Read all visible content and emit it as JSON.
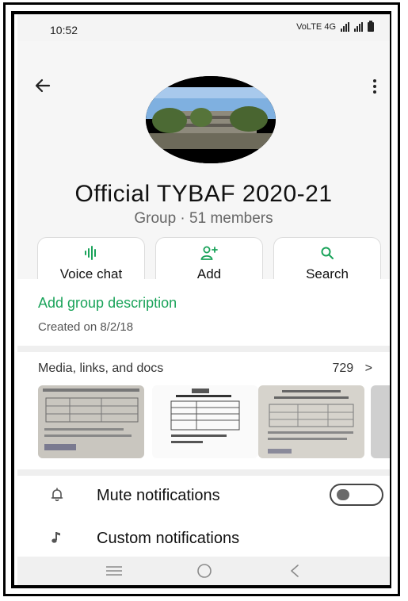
{
  "status_bar": {
    "time": "10:52",
    "network": "VoLTE 4G"
  },
  "header": {
    "title": "Official TYBAF 2020-21",
    "subtitle": "Group · 51 members"
  },
  "actions": {
    "voice_chat": "Voice chat",
    "add": "Add",
    "search": "Search"
  },
  "description": {
    "add_link": "Add group description",
    "created": "Created on 8/2/18"
  },
  "media": {
    "title": "Media, links, and docs",
    "count": "729",
    "chevron": ">"
  },
  "notifications": {
    "mute_label": "Mute notifications",
    "mute_enabled": false,
    "custom_label": "Custom notifications"
  },
  "colors": {
    "accent_green": "#1aa35a",
    "text_primary": "#111111",
    "text_secondary": "#666666"
  },
  "icons": {
    "back": "arrow-left-icon",
    "more": "more-vertical-icon",
    "voice": "voice-wave-icon",
    "add": "add-person-icon",
    "search": "search-icon",
    "mute": "bell-icon",
    "custom": "music-note-icon"
  }
}
